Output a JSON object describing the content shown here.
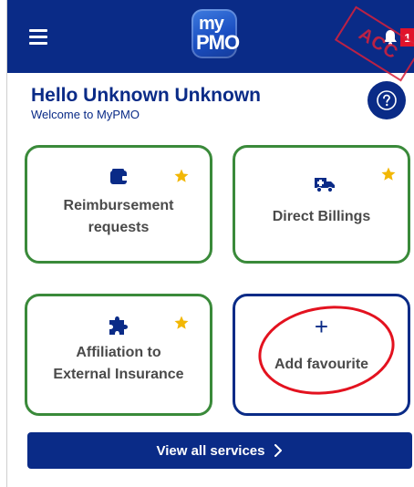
{
  "header": {
    "logo": {
      "line1": "my",
      "line2": "PMO"
    },
    "notification_count": "1",
    "stamp_text": "ACC"
  },
  "greeting": {
    "title": "Hello Unknown Unknown",
    "subtitle": "Welcome to MyPMO"
  },
  "services": [
    {
      "label_line1": "Reimbursement",
      "label_line2": "requests",
      "icon": "wallet-icon",
      "favourite": true
    },
    {
      "label_line1": "Direct Billings",
      "icon": "ambulance-icon",
      "favourite": true
    },
    {
      "label_line1": "Affiliation to",
      "label_line2": "External Insurance",
      "icon": "puzzle-icon",
      "favourite": true
    },
    {
      "label_line1": "Add favourite",
      "icon": "plus-icon",
      "favourite": false
    }
  ],
  "add_favourite_symbol": "+",
  "view_all_label": "View all services",
  "colors": {
    "primary": "#0a2b87",
    "card_green": "#3a8a3a",
    "star": "#f2b705",
    "badge": "#e0132b",
    "annotation_red": "#e3121f"
  }
}
